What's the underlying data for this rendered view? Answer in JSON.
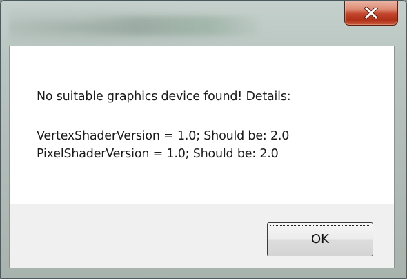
{
  "window": {
    "title": "",
    "close_icon": "close-icon"
  },
  "message": {
    "line1": "No suitable graphics device found! Details:",
    "line2": "VertexShaderVersion = 1.0; Should be: 2.0",
    "line3": "PixelShaderVersion = 1.0; Should be: 2.0"
  },
  "buttons": {
    "ok_label": "OK"
  },
  "colors": {
    "close_button": "#c7452c",
    "button_bar": "#f0f0f0",
    "message_background": "#ffffff"
  }
}
